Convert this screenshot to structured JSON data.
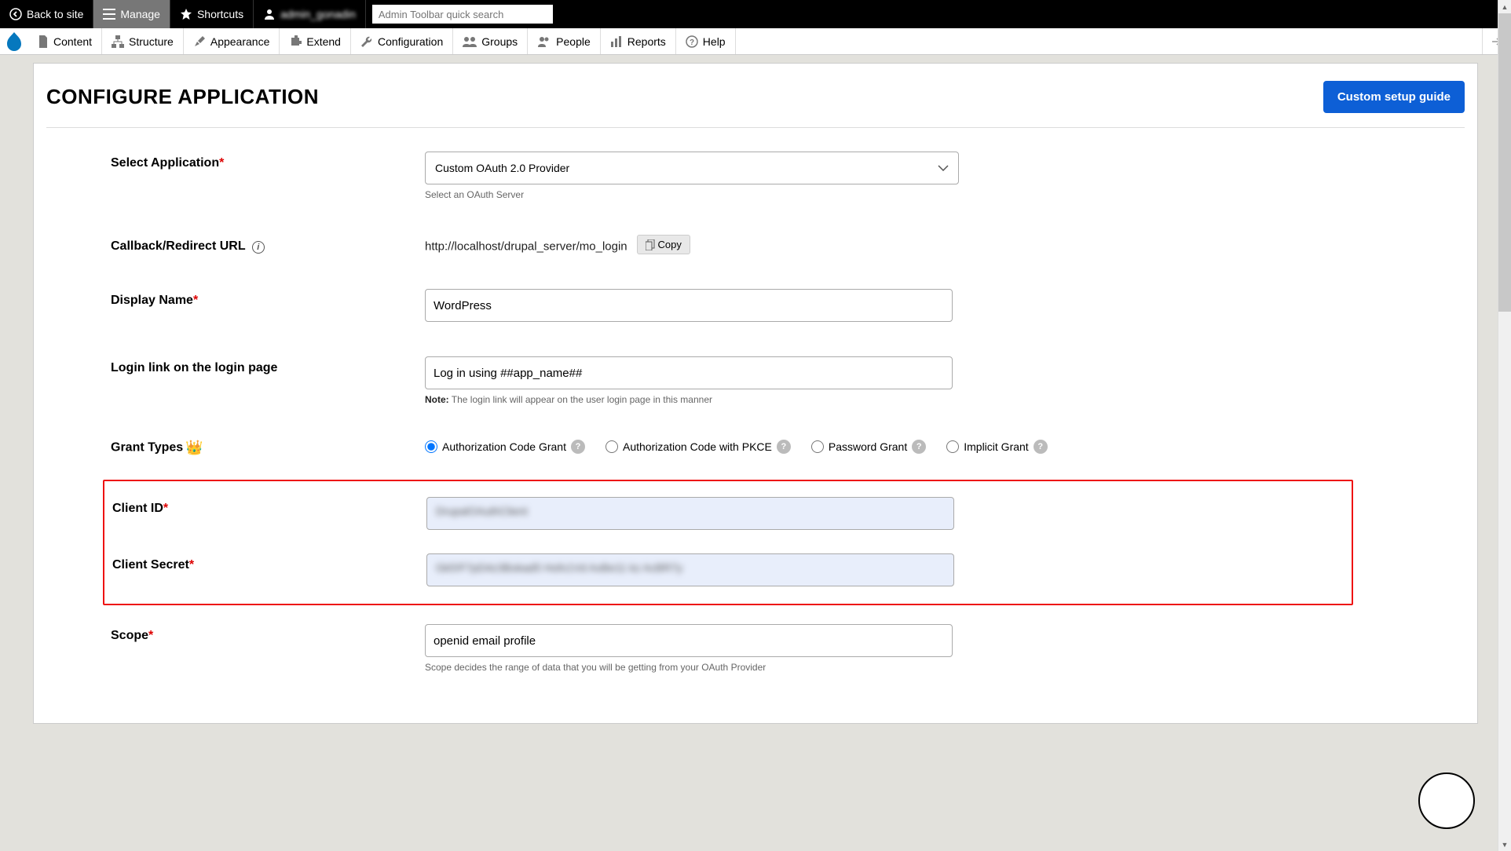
{
  "toolbar": {
    "back": "Back to site",
    "manage": "Manage",
    "shortcuts": "Shortcuts",
    "user": "admin_gonadin",
    "search_placeholder": "Admin Toolbar quick search"
  },
  "subnav": {
    "items": [
      "Content",
      "Structure",
      "Appearance",
      "Extend",
      "Configuration",
      "Groups",
      "People",
      "Reports",
      "Help"
    ]
  },
  "page": {
    "title": "CONFIGURE APPLICATION",
    "setup_guide": "Custom setup guide"
  },
  "form": {
    "select_app": {
      "label": "Select Application",
      "value": "Custom OAuth 2.0 Provider",
      "helper": "Select an OAuth Server"
    },
    "callback": {
      "label": "Callback/Redirect URL",
      "value": "http://localhost/drupal_server/mo_login",
      "copy": "Copy"
    },
    "display_name": {
      "label": "Display Name",
      "value": "WordPress"
    },
    "login_link": {
      "label": "Login link on the login page",
      "value": "Log in using ##app_name##",
      "note_label": "Note:",
      "note_text": " The login link will appear on the user login page in this manner"
    },
    "grant": {
      "label": "Grant Types",
      "options": [
        "Authorization Code Grant",
        "Authorization Code with PKCE",
        "Password Grant",
        "Implicit Grant"
      ]
    },
    "client_id": {
      "label": "Client ID",
      "value": "DrupalOAuthClient"
    },
    "client_secret": {
      "label": "Client Secret",
      "value": "Gk5!F7pD4z3Bokad5 Hofx1Vd AxBe11 kz AcBR7y"
    },
    "scope": {
      "label": "Scope",
      "value": "openid email profile",
      "helper": "Scope decides the range of data that you will be getting from your OAuth Provider"
    }
  }
}
